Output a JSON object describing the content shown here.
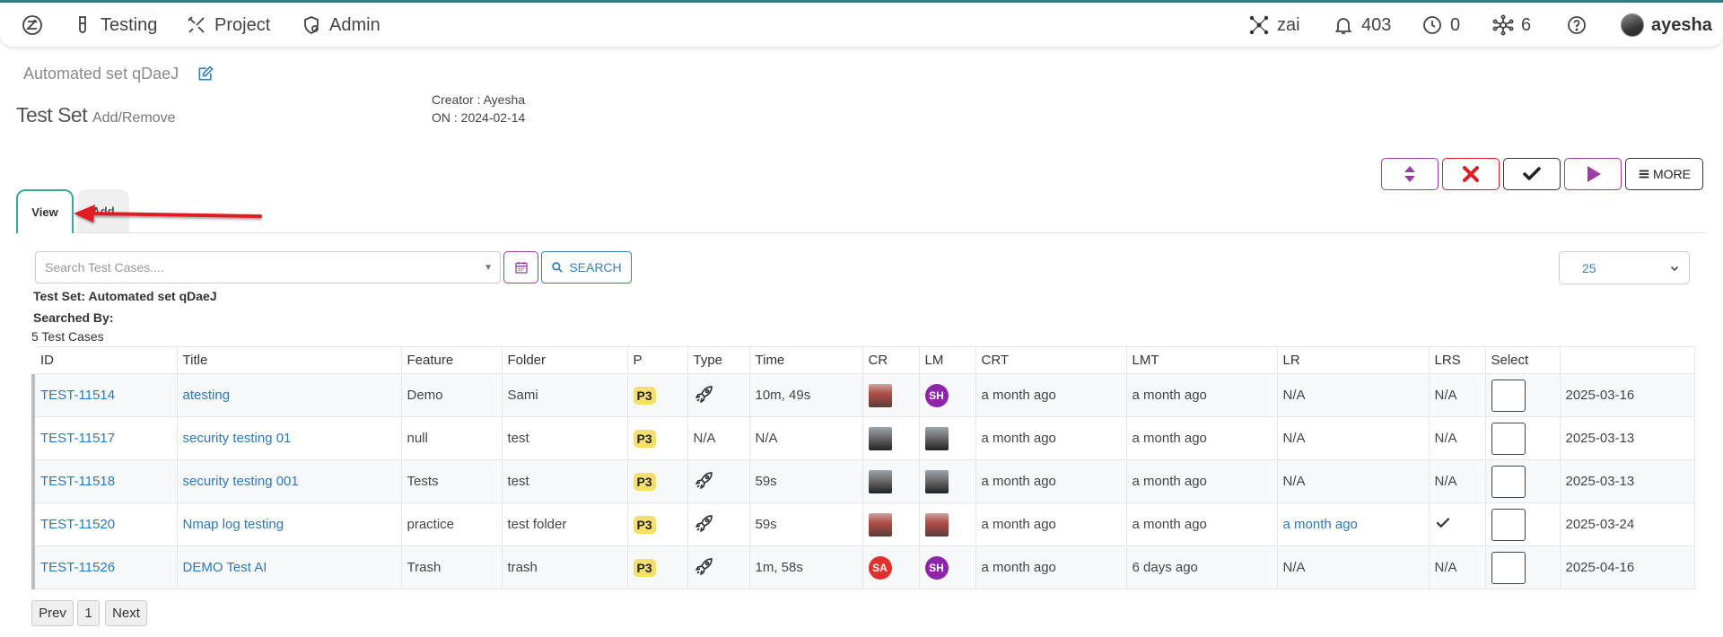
{
  "nav": {
    "testing": "Testing",
    "project": "Project",
    "admin": "Admin",
    "zai": "zai",
    "notifications": "403",
    "timers": "0",
    "network": "6",
    "username": "ayesha"
  },
  "header": {
    "set_name": "Automated set qDaeJ",
    "title": "Test Set",
    "subtitle": "Add/Remove",
    "creator": "Creator : Ayesha",
    "created_on": "ON : 2024-02-14"
  },
  "actions": {
    "more_label": "MORE"
  },
  "tabs": {
    "view": "View",
    "add": "Add"
  },
  "search": {
    "placeholder": "Search Test Cases....",
    "button_label": "SEARCH",
    "page_size": "25"
  },
  "info": {
    "test_set": "Test Set: Automated set qDaeJ",
    "searched_by": "Searched By:",
    "count": "5 Test Cases"
  },
  "table": {
    "columns": [
      "ID",
      "Title",
      "Feature",
      "Folder",
      "P",
      "Type",
      "Time",
      "CR",
      "LM",
      "CRT",
      "LMT",
      "LR",
      "LRS",
      "Select",
      ""
    ],
    "rows": [
      {
        "id": "TEST-11514",
        "title": "atesting",
        "feature": "Demo",
        "folder": "Sami",
        "p": "P3",
        "type": "rocket",
        "time": "10m, 49s",
        "cr": "img-red",
        "lm": "SH",
        "crt": "a month ago",
        "lmt": "a month ago",
        "lr": "N/A",
        "lrs": "N/A",
        "date": "2025-03-16"
      },
      {
        "id": "TEST-11517",
        "title": "security testing 01",
        "feature": "null",
        "folder": "test",
        "p": "P3",
        "type": "N/A",
        "time": "N/A",
        "cr": "img-dark",
        "lm": "img-dark",
        "crt": "a month ago",
        "lmt": "a month ago",
        "lr": "N/A",
        "lrs": "N/A",
        "date": "2025-03-13"
      },
      {
        "id": "TEST-11518",
        "title": "security testing 001",
        "feature": "Tests",
        "folder": "test",
        "p": "P3",
        "type": "rocket",
        "time": "59s",
        "cr": "img-dark",
        "lm": "img-dark",
        "crt": "a month ago",
        "lmt": "a month ago",
        "lr": "N/A",
        "lrs": "N/A",
        "date": "2025-03-13"
      },
      {
        "id": "TEST-11520",
        "title": "Nmap log testing",
        "feature": "practice",
        "folder": "test folder",
        "p": "P3",
        "type": "rocket",
        "time": "59s",
        "cr": "img-red",
        "lm": "img-red",
        "crt": "a month ago",
        "lmt": "a month ago",
        "lr": "a month ago",
        "lrs": "check",
        "date": "2025-03-24"
      },
      {
        "id": "TEST-11526",
        "title": "DEMO Test AI",
        "feature": "Trash",
        "folder": "trash",
        "p": "P3",
        "type": "rocket",
        "time": "1m, 58s",
        "cr": "SA",
        "lm": "SH",
        "crt": "a month ago",
        "lmt": "6 days ago",
        "lr": "N/A",
        "lrs": "N/A",
        "date": "2025-04-16"
      }
    ]
  },
  "pagination": {
    "prev": "Prev",
    "page": "1",
    "next": "Next"
  },
  "colors": {
    "accent": "#2f7f82",
    "link": "#2f77b7",
    "purple": "#9b3ea5",
    "red": "#e01b24",
    "badge": "#f6df6d",
    "sa_avatar": "#e0312d",
    "sh_avatar": "#8e24aa"
  }
}
